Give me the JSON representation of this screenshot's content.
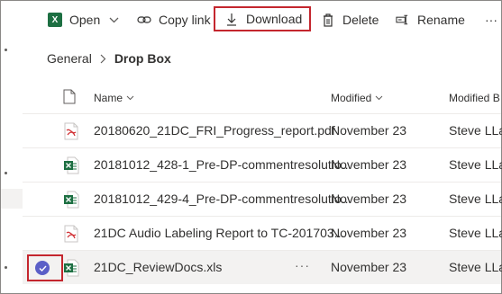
{
  "toolbar": {
    "open_label": "Open",
    "copy_link_label": "Copy link",
    "download_label": "Download",
    "delete_label": "Delete",
    "rename_label": "Rename",
    "more_label": "···"
  },
  "breadcrumb": {
    "parent": "General",
    "current": "Drop Box"
  },
  "table": {
    "columns": {
      "name": "Name",
      "modified": "Modified",
      "modified_by": "Modified B"
    },
    "rows": [
      {
        "icon": "pdf-file-icon",
        "name": "20180620_21DC_FRI_Progress_report.pdf",
        "modified": "November 23",
        "modified_by": "Steve LLa"
      },
      {
        "icon": "excel-file-icon",
        "name": "20181012_428-1_Pre-DP-commentresolutio...",
        "modified": "November 23",
        "modified_by": "Steve LLa"
      },
      {
        "icon": "excel-file-icon",
        "name": "20181012_429-4_Pre-DP-commentresolutio...",
        "modified": "November 23",
        "modified_by": "Steve LLa"
      },
      {
        "icon": "pdf-file-icon",
        "name": "21DC Audio Labeling Report to TC-201703...",
        "modified": "November 23",
        "modified_by": "Steve LLa"
      },
      {
        "icon": "excel-file-icon",
        "name": "21DC_ReviewDocs.xls",
        "modified": "November 23",
        "modified_by": "Steve LLa",
        "selected": true,
        "more": "···"
      }
    ]
  },
  "colors": {
    "accent_highlight": "#c4262e",
    "excel_green": "#1d6f42",
    "pdf_red": "#d13438",
    "check_purple": "#5b5fc7",
    "selected_row": "#f3f2f1"
  }
}
